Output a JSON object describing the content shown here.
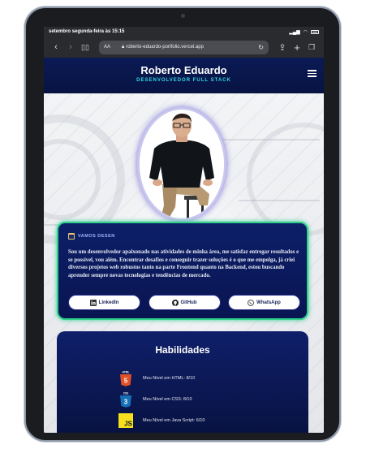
{
  "status_bar": {
    "datetime": "setembro segunda-feira às 15:15"
  },
  "browser": {
    "text_size_label": "AA",
    "url": "roberto-eduardo-portfolio.vercel.app"
  },
  "header": {
    "name": "Roberto Eduardo",
    "role": "DESENVOLVEDOR FULL STACK"
  },
  "about": {
    "heading": "VAMOS DESEN",
    "text": "Sou um desenvolvedor apaixonado nas atividades de minha área, me satisfaz entregar resultados e se possível, vou além. Encontrar desafios e conseguir trazer soluções é o que me empolga, já criei diversos projetos web robustos tanto na parte Frontend quanto na Backend, estou buscando aprender sempre novas tecnologias e tendências de mercado.",
    "buttons": [
      {
        "label": "LinkedIn",
        "icon": "linkedin-icon"
      },
      {
        "label": "GitHub",
        "icon": "github-icon"
      },
      {
        "label": "WhatsApp",
        "icon": "whatsapp-icon"
      }
    ]
  },
  "skills": {
    "title": "Habilidades",
    "items": [
      {
        "logo_text": "HTML",
        "number": "5",
        "label": "Meu Nível em HTML: 8/10",
        "color": "#e34f26"
      },
      {
        "logo_text": "CSS",
        "number": "3",
        "label": "Meu Nível em CSS: 8/10",
        "color": "#1572b6"
      },
      {
        "logo_text": "JS",
        "label": "Meu Nível em Java Script: 6/10",
        "color": "#f7df1e"
      }
    ]
  }
}
